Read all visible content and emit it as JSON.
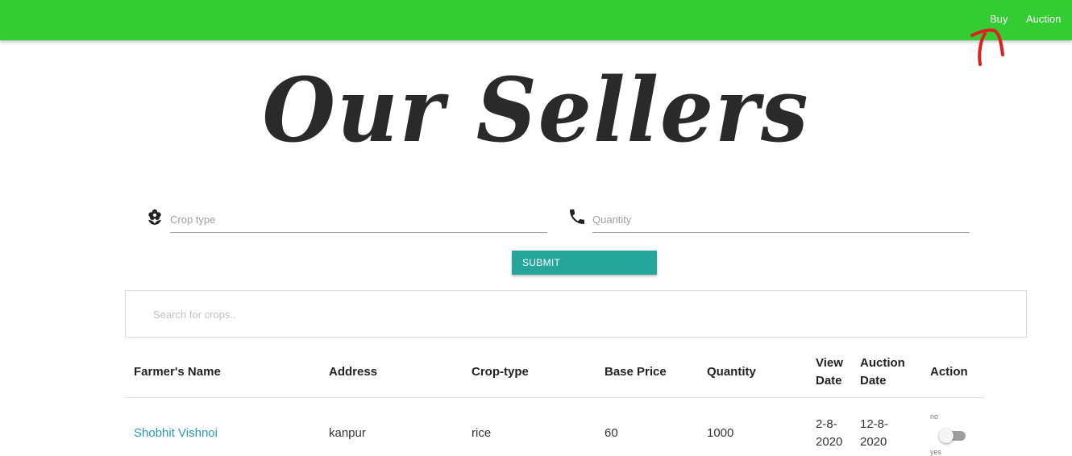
{
  "nav": {
    "buy_label": "Buy",
    "auction_label": "Auction"
  },
  "page": {
    "title": "Our Sellers"
  },
  "form": {
    "crop_type_placeholder": "Crop type",
    "quantity_placeholder": "Quantity",
    "submit_label": "SUBMIT"
  },
  "search": {
    "placeholder": "Search for crops.."
  },
  "table": {
    "headers": {
      "farmer_name": "Farmer's Name",
      "address": "Address",
      "crop_type": "Crop-type",
      "base_price": "Base Price",
      "quantity": "Quantity",
      "view_date_1": "View",
      "view_date_2": "Date",
      "auction_date_1": "Auction",
      "auction_date_2": "Date",
      "action": "Action"
    },
    "rows": [
      {
        "farmer_name": "Shobhit Vishnoi",
        "address": "kanpur",
        "crop_type": "rice",
        "base_price": "60",
        "quantity": "1000",
        "view_date_1": "2-8-",
        "view_date_2": "2020",
        "auction_date_1": "12-8-",
        "auction_date_2": "2020",
        "switch_off_label": "no",
        "switch_on_label": "yes",
        "switch_on": false
      }
    ]
  },
  "colors": {
    "navbar": "#33cc33",
    "submit": "#26a69a",
    "link": "#2a95c0",
    "annotation": "#e02020"
  },
  "icons": {
    "crop_field": "flower-icon",
    "quantity_field": "phone-icon"
  }
}
